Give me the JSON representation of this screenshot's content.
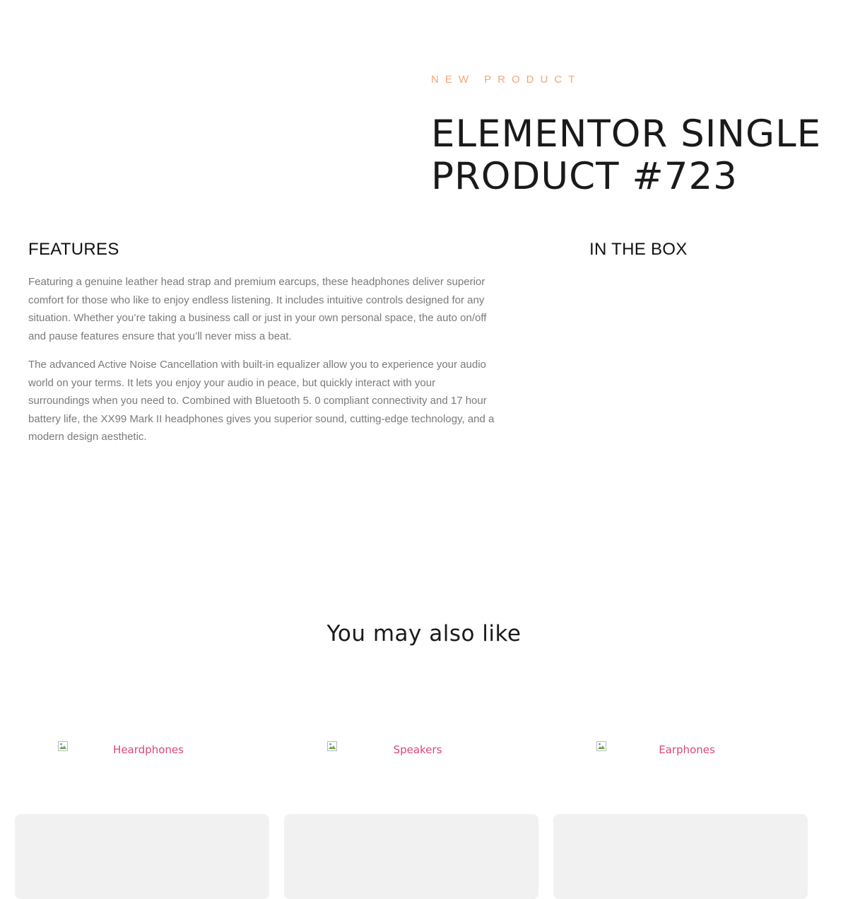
{
  "hero": {
    "eyebrow": "NEW PRODUCT",
    "title": "ELEMENTOR SINGLE PRODUCT #723"
  },
  "features": {
    "heading": "FEATURES",
    "paragraphs": [
      "Featuring a genuine leather head strap and premium earcups, these headphones deliver superior comfort for those who like to enjoy endless listening. It includes intuitive controls designed for any situation. Whether you’re taking a business call or just in your own personal space, the auto on/off and pause features ensure that you’ll never miss a beat.",
      "The advanced Active Noise Cancellation with built-in equalizer allow you to experience your audio world on your terms. It lets you enjoy your audio in peace, but quickly interact with your surroundings when you need to. Combined with Bluetooth 5. 0 compliant connectivity and 17 hour battery life, the XX99 Mark II headphones gives you superior sound, cutting-edge technology, and a modern design aesthetic."
    ]
  },
  "in_the_box": {
    "heading": "IN THE BOX"
  },
  "also_like": {
    "heading": "You may also like",
    "categories": [
      {
        "label": "Heardphones",
        "icon": "broken-image-icon"
      },
      {
        "label": "Speakers",
        "icon": "broken-image-icon"
      },
      {
        "label": "Earphones",
        "icon": "broken-image-icon"
      }
    ]
  },
  "colors": {
    "accent": "#f0a878",
    "link": "#d6487a",
    "body_text": "#7a7a7a",
    "card_bg": "#f1f1f1"
  }
}
